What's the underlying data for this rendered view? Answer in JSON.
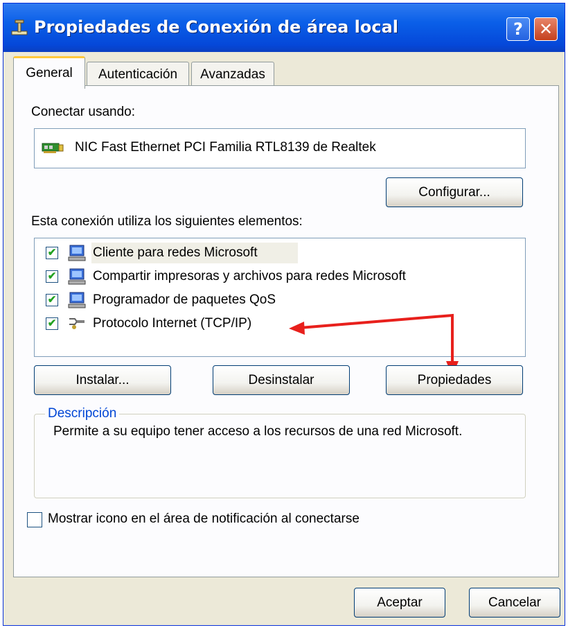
{
  "window": {
    "title": "Propiedades de Conexión de área local",
    "help_label": "?",
    "close_label": "✕"
  },
  "tabs": [
    {
      "label": "General",
      "active": true
    },
    {
      "label": "Autenticación",
      "active": false
    },
    {
      "label": "Avanzadas",
      "active": false
    }
  ],
  "general": {
    "connect_using_label": "Conectar usando:",
    "adapter_name": "NIC Fast Ethernet PCI Familia RTL8139 de Realtek",
    "configure_button": "Configurar...",
    "components_label": "Esta conexión utiliza los siguientes elementos:",
    "components": [
      {
        "label": "Cliente para redes Microsoft",
        "checked": true,
        "selected": true,
        "icon": "computer-network-icon"
      },
      {
        "label": "Compartir impresoras y archivos para redes Microsoft",
        "checked": true,
        "selected": false,
        "icon": "computer-network-icon"
      },
      {
        "label": "Programador de paquetes QoS",
        "checked": true,
        "selected": false,
        "icon": "computer-network-icon"
      },
      {
        "label": "Protocolo Internet (TCP/IP)",
        "checked": true,
        "selected": false,
        "icon": "network-protocol-icon"
      }
    ],
    "install_button": "Instalar...",
    "uninstall_button": "Desinstalar",
    "properties_button": "Propiedades",
    "description_title": "Descripción",
    "description_text": "Permite a su equipo tener acceso a los recursos de una red Microsoft.",
    "show_icon_label": "Mostrar icono en el área de notificación al conectarse",
    "show_icon_checked": false
  },
  "footer": {
    "ok_button": "Aceptar",
    "cancel_button": "Cancelar"
  },
  "colors": {
    "titlebar": "#0548d9",
    "dialog_bg": "#ece9d8",
    "annotation_arrow": "#e8201c",
    "check": "#21a121"
  }
}
